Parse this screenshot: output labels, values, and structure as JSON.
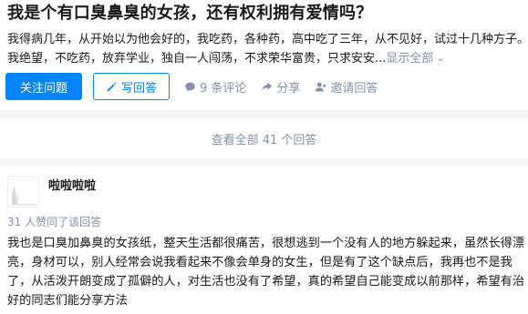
{
  "question": {
    "title": "我是个有口臭鼻臭的女孩，还有权利拥有爱情吗？",
    "excerpt_line1": "我得病几年，从开始以为他会好的，我吃药，各种药，高中吃了三年，从不见好，试过十几种方子。",
    "excerpt_line2": "我绝望，不吃药，放弃学业，独自一人闯荡，不求荣华富贵，只求安安...",
    "show_all": "显示全部",
    "show_all_icon": "chevron-down-icon"
  },
  "actions": {
    "follow": "关注问题",
    "write_answer": "写回答",
    "comments": "9 条评论",
    "share": "分享",
    "invite": "邀请回答"
  },
  "view_all": "查看全部 41 个回答",
  "answer": {
    "author": "啦啦啦啦",
    "votes": "31 人赞同了该回答",
    "lines": [
      "我也是口臭加鼻臭的女孩纸，整天生活都很痛苦，很想逃到一个没有人的地方躲起来，虽然长得漂",
      "亮，身材可以，别人经常会说我看起来不像会单身的女生，但是有了这个缺点后，我再也不是我",
      "了，从活泼开朗变成了孤僻的人，对生活也没有了希望，真的希望自己能变成以前那样，希望有治",
      "好的同志们能分享方法"
    ]
  },
  "colors": {
    "accent": "#0084ff",
    "muted": "#8590a6",
    "background": "#f6f6f6"
  }
}
